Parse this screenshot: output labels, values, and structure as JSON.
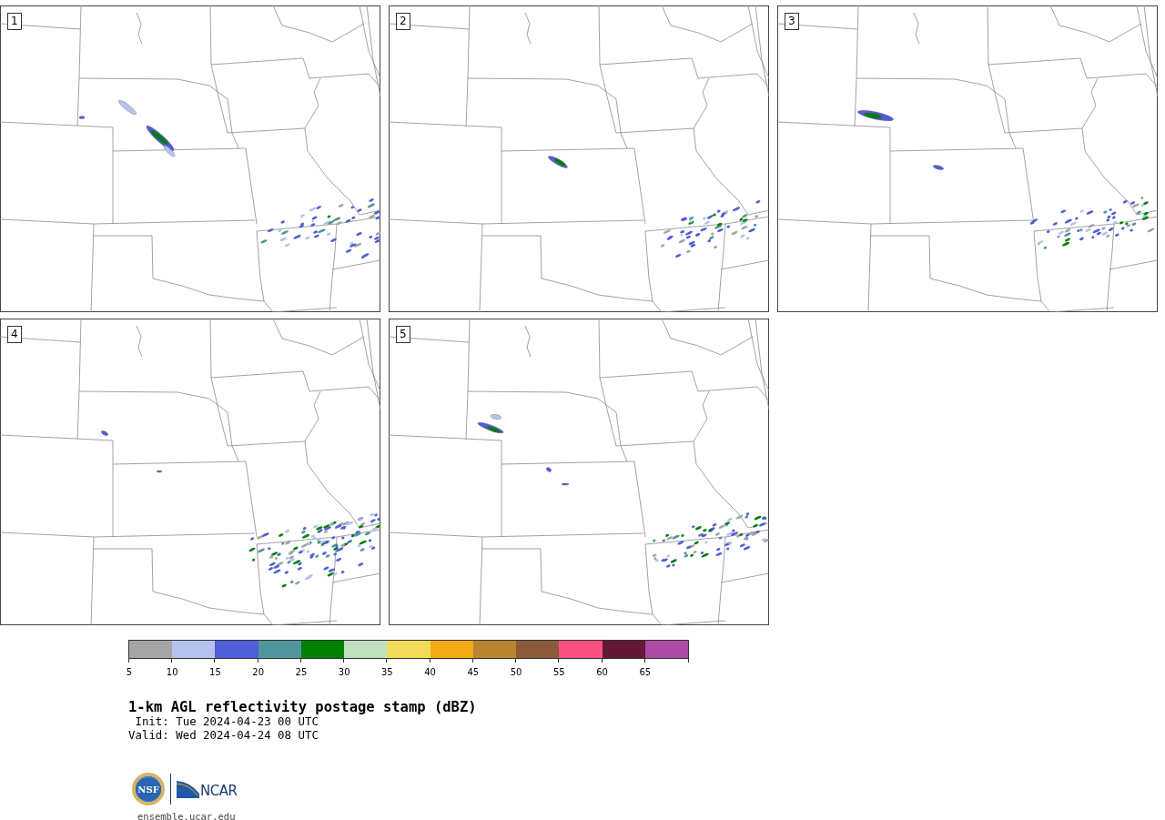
{
  "panels": [
    {
      "label": "1"
    },
    {
      "label": "2"
    },
    {
      "label": "3"
    },
    {
      "label": "4"
    },
    {
      "label": "5"
    }
  ],
  "colorbar": {
    "bins": [
      {
        "tick": "5",
        "color": "#a5a5a5"
      },
      {
        "tick": "10",
        "color": "#b6c2ee"
      },
      {
        "tick": "15",
        "color": "#505ed8"
      },
      {
        "tick": "20",
        "color": "#4f969c"
      },
      {
        "tick": "25",
        "color": "#008000"
      },
      {
        "tick": "30",
        "color": "#bfdfbf"
      },
      {
        "tick": "35",
        "color": "#f0dc5a"
      },
      {
        "tick": "40",
        "color": "#f0aa14"
      },
      {
        "tick": "45",
        "color": "#b88430"
      },
      {
        "tick": "50",
        "color": "#8b5a3c"
      },
      {
        "tick": "55",
        "color": "#f5507e"
      },
      {
        "tick": "60",
        "color": "#611937"
      },
      {
        "tick": "65",
        "color": "#ad4aa6"
      }
    ]
  },
  "title": "1-km AGL reflectivity postage stamp (dBZ)",
  "init": "Init: Tue 2024-04-23 00 UTC",
  "valid": "Valid: Wed 2024-04-24 08 UTC",
  "logos": {
    "nsf": "NSF",
    "ncar": "NCAR"
  },
  "url": "ensemble.ucar.edu"
}
